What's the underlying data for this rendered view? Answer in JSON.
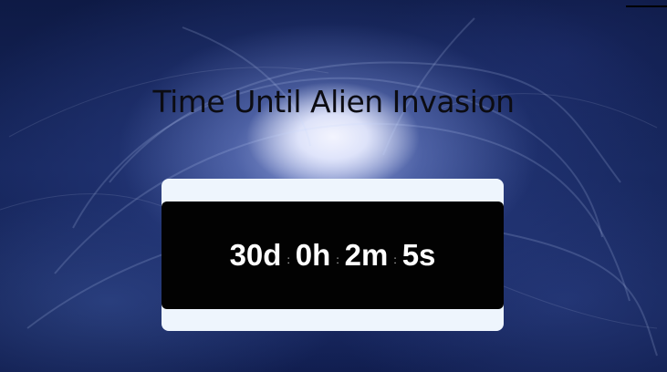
{
  "page": {
    "title": "Time Until Alien Invasion"
  },
  "countdown": {
    "days": "30d",
    "hours": "0h",
    "minutes": "2m",
    "seconds": "5s",
    "separator": ":"
  },
  "colors": {
    "background_galaxy": "#16265c",
    "card_background": "#eef5fd",
    "display_background": "#020202",
    "display_text": "#ffffff",
    "title_text": "#0c0c12"
  }
}
